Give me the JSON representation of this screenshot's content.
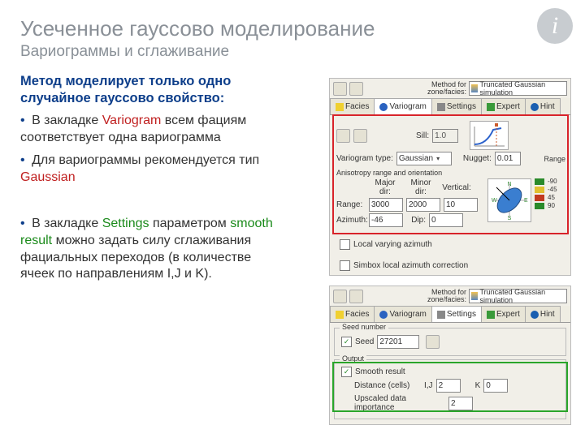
{
  "title": "Усеченное гауссово моделирование",
  "subtitle": "Вариограммы и сглаживание",
  "lead": "Метод моделирует только одно случайное гауссово свойство:",
  "b1_a": "В закладке ",
  "b1_v": "Variogram",
  "b1_b": " всем фациям соответствует одна вариограмма",
  "b2_a": "Для вариограммы рекомендуется тип ",
  "b2_g": "Gaussian",
  "b3_a": "В закладке ",
  "b3_s": "Settings",
  "b3_b": " параметром ",
  "b3_sm": "smooth result",
  "b3_c": " можно задать силу сглаживания фациальных переходов (в количестве ячеек по направлениям I,J и K).",
  "panel": {
    "method_label": "Method for\nzone/facies:",
    "method_value": "Truncated Gaussian simulation",
    "tabs": {
      "facies": "Facies",
      "variogram": "Variogram",
      "settings": "Settings",
      "expert": "Expert",
      "hint": "Hint"
    },
    "sill_label": "Sill:",
    "sill": "1.0",
    "nugget_label": "Nugget:",
    "nugget": "0.01",
    "vtype_label": "Variogram type:",
    "vtype": "Gaussian",
    "aniso": "Anisotropy range and orientation",
    "major": "Major dir:",
    "minor": "Minor dir:",
    "vertical": "Vertical:",
    "range_label": "Range:",
    "r_major": "3000",
    "r_minor": "2000",
    "r_vert": "10",
    "azimuth_label": "Azimuth:",
    "az": "-46",
    "dip_label": "Dip:",
    "dip": "0",
    "angle_m90": "-90",
    "angle_m45": "-45",
    "angle_45": "45",
    "angle_90": "90",
    "lva": "Local varying azimuth",
    "simbox": "Simbox local azimuth correction",
    "seed_section": "Seed number",
    "seed_label": "Seed",
    "seed": "27201",
    "output": "Output",
    "smooth": "Smooth result",
    "dist_label": "Distance (cells)",
    "ij": "I,J",
    "ij_v": "2",
    "k": "K",
    "k_v": "0",
    "upscaled": "Upscaled data importance",
    "up_v": "2",
    "range_word": "Range"
  }
}
